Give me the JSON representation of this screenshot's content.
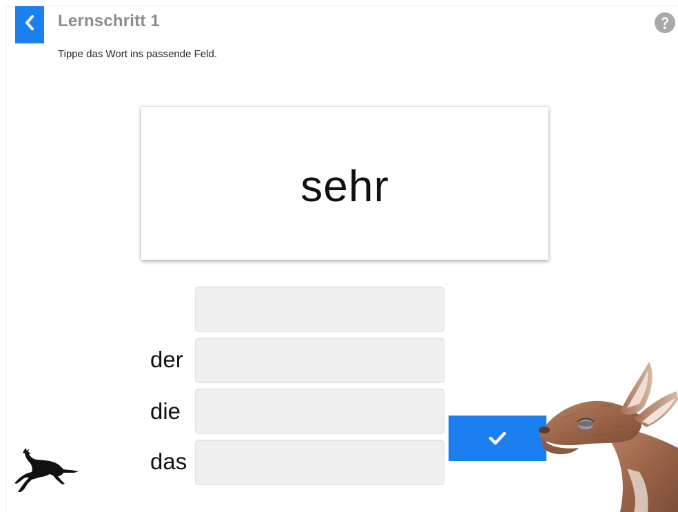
{
  "header": {
    "back_icon": "chevron-left-icon",
    "title": "Lernschritt 1",
    "help_icon": "question-circle-icon"
  },
  "instruction": "Tippe das Wort ins passende Feld.",
  "word_card": {
    "word": "sehr"
  },
  "answer_fields": [
    {
      "label": "",
      "value": ""
    },
    {
      "label": "der",
      "value": ""
    },
    {
      "label": "die",
      "value": ""
    },
    {
      "label": "das",
      "value": ""
    }
  ],
  "check_button": {
    "icon": "checkmark-icon"
  },
  "colors": {
    "accent": "#1b7ff0",
    "field_background": "#f0f0f0",
    "title_gray": "#8c8c8c"
  },
  "decorations": {
    "logo": "leaping-deer-silhouette",
    "illustration": "deer-head-painting"
  }
}
